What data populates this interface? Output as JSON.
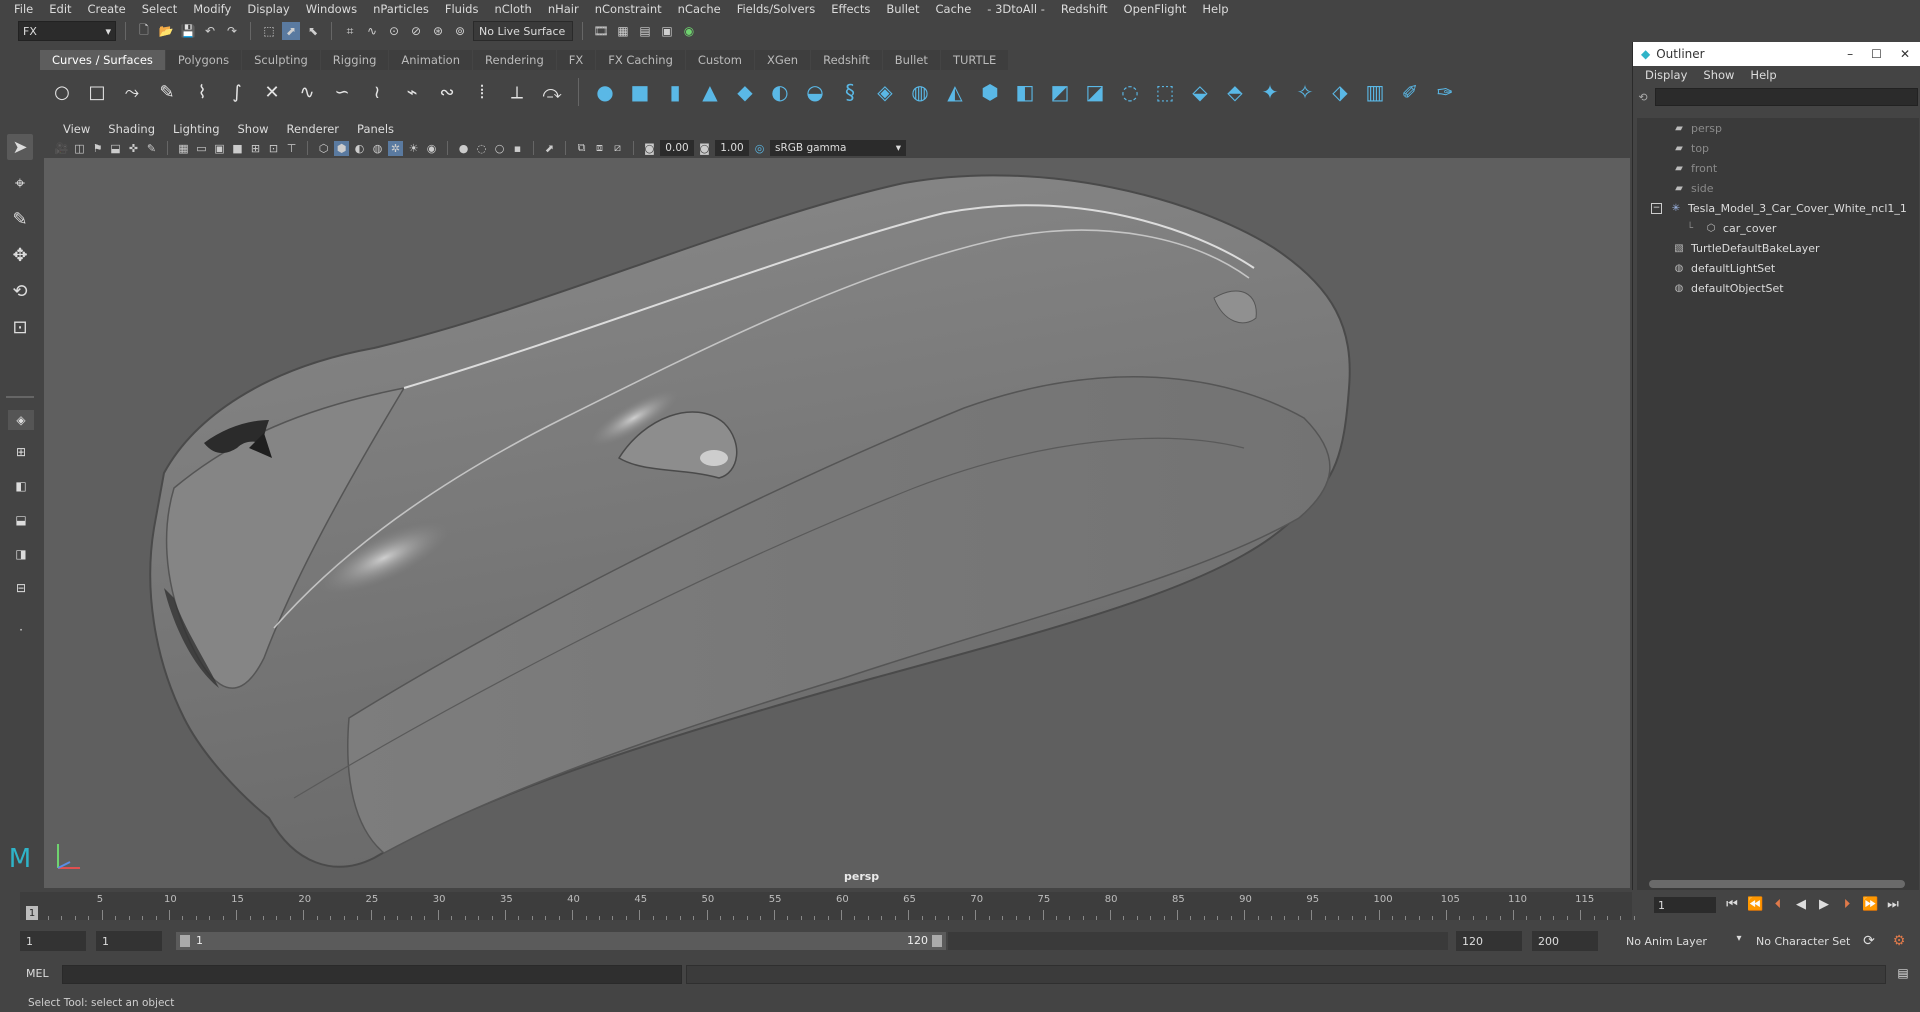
{
  "menubar": [
    "File",
    "Edit",
    "Create",
    "Select",
    "Modify",
    "Display",
    "Windows",
    "nParticles",
    "Fluids",
    "nCloth",
    "nHair",
    "nConstraint",
    "nCache",
    "Fields/Solvers",
    "Effects",
    "Bullet",
    "Cache",
    "- 3DtoAll -",
    "Redshift",
    "OpenFlight",
    "Help"
  ],
  "statusline": {
    "mode": "FX",
    "live_surface": "No Live Surface"
  },
  "shelf_tabs": [
    "Curves / Surfaces",
    "Polygons",
    "Sculpting",
    "Rigging",
    "Animation",
    "Rendering",
    "FX",
    "FX Caching",
    "Custom",
    "XGen",
    "Redshift",
    "Bullet",
    "TURTLE"
  ],
  "shelf_active": "Curves / Surfaces",
  "viewport": {
    "menu": [
      "View",
      "Shading",
      "Lighting",
      "Show",
      "Renderer",
      "Panels"
    ],
    "exposure": "0.00",
    "gamma": "1.00",
    "color_space": "sRGB gamma",
    "camera": "persp"
  },
  "outliner": {
    "title": "Outliner",
    "menu": [
      "Display",
      "Show",
      "Help"
    ],
    "items": [
      {
        "label": "persp",
        "type": "camera",
        "dim": true
      },
      {
        "label": "top",
        "type": "camera",
        "dim": true
      },
      {
        "label": "front",
        "type": "camera",
        "dim": true
      },
      {
        "label": "side",
        "type": "camera",
        "dim": true
      },
      {
        "label": "Tesla_Model_3_Car_Cover_White_ncl1_1",
        "type": "group",
        "dim": false
      },
      {
        "label": "car_cover",
        "type": "mesh",
        "dim": false
      },
      {
        "label": "TurtleDefaultBakeLayer",
        "type": "layer",
        "dim": false
      },
      {
        "label": "defaultLightSet",
        "type": "set",
        "dim": false
      },
      {
        "label": "defaultObjectSet",
        "type": "set",
        "dim": false
      }
    ]
  },
  "timeslider": {
    "ticks": [
      "5",
      "10",
      "15",
      "20",
      "25",
      "30",
      "35",
      "40",
      "45",
      "50",
      "55",
      "60",
      "65",
      "70",
      "75",
      "80",
      "85",
      "90",
      "95",
      "100",
      "105",
      "110",
      "115"
    ],
    "current_marker": "1",
    "current_frame": "1"
  },
  "range": {
    "start": "1",
    "playback_start": "1",
    "bar_start": "1",
    "bar_end": "120",
    "playback_end": "120",
    "end": "200",
    "anim_layer": "No Anim Layer",
    "character_set": "No Character Set"
  },
  "cmd": {
    "label": "MEL"
  },
  "help_line": "Select Tool: select an object"
}
